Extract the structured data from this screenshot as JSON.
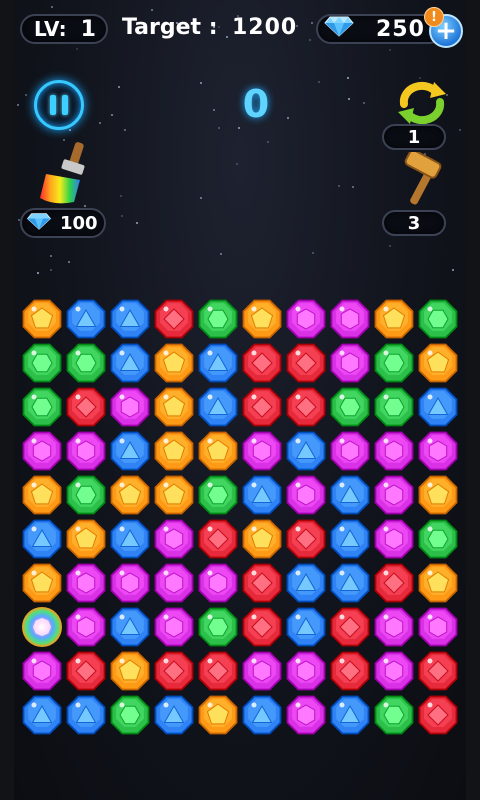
{
  "hud": {
    "level_label": "LV:",
    "level_value": "1",
    "target_label": "Target :",
    "target_value": "1200",
    "gem_balance": "250",
    "plus_icon": "plus-icon",
    "alert_badge": "!"
  },
  "score": "0",
  "boosters": {
    "brush": {
      "icon": "paint-brush-icon",
      "price": "100"
    },
    "shuffle": {
      "icon": "shuffle-arrows-icon",
      "count": "1"
    },
    "hammer": {
      "icon": "hammer-icon",
      "count": "3"
    }
  },
  "board": {
    "rows": 10,
    "cols": 10,
    "grid": [
      [
        "orange",
        "blue",
        "blue",
        "red",
        "green",
        "orange",
        "magenta",
        "magenta",
        "orange",
        "green"
      ],
      [
        "green",
        "green",
        "blue",
        "orange",
        "blue",
        "red",
        "red",
        "magenta",
        "green",
        "orange"
      ],
      [
        "green",
        "red",
        "magenta",
        "orange",
        "blue",
        "red",
        "red",
        "green",
        "green",
        "blue"
      ],
      [
        "magenta",
        "magenta",
        "blue",
        "orange",
        "orange",
        "magenta",
        "blue",
        "magenta",
        "magenta",
        "magenta"
      ],
      [
        "orange",
        "green",
        "orange",
        "orange",
        "green",
        "blue",
        "magenta",
        "blue",
        "magenta",
        "orange"
      ],
      [
        "blue",
        "orange",
        "blue",
        "magenta",
        "red",
        "orange",
        "red",
        "blue",
        "magenta",
        "green"
      ],
      [
        "orange",
        "magenta",
        "magenta",
        "magenta",
        "magenta",
        "red",
        "blue",
        "blue",
        "red",
        "orange"
      ],
      [
        "rainbow",
        "magenta",
        "blue",
        "magenta",
        "green",
        "red",
        "blue",
        "red",
        "magenta",
        "magenta"
      ],
      [
        "magenta",
        "red",
        "orange",
        "red",
        "red",
        "magenta",
        "magenta",
        "red",
        "magenta",
        "red"
      ],
      [
        "blue",
        "blue",
        "green",
        "blue",
        "orange",
        "blue",
        "magenta",
        "blue",
        "green",
        "red"
      ]
    ]
  },
  "colors": {
    "orange": "#ff9a16",
    "blue": "#2f83f4",
    "red": "#e62a3c",
    "green": "#2cc04a",
    "magenta": "#d932e6",
    "score_glow": "#5fd4ff",
    "pause_ring": "#36c8ff"
  }
}
